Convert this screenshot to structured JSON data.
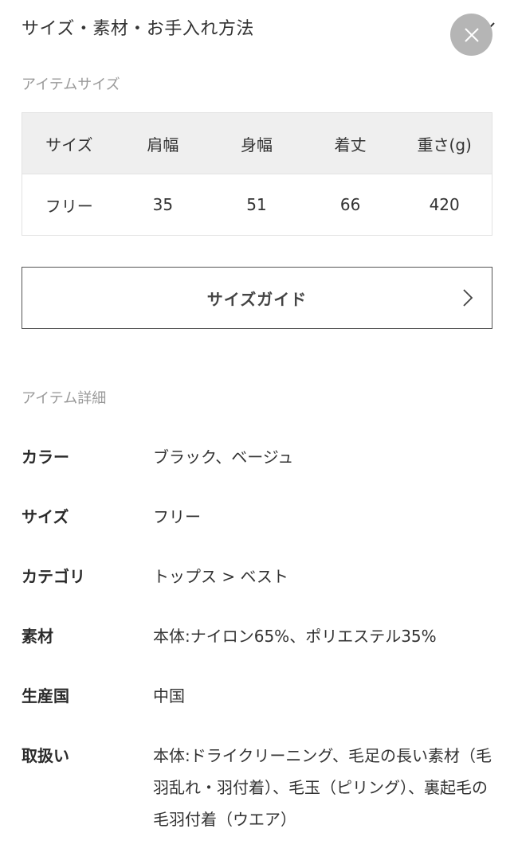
{
  "header": {
    "title": "サイズ・素材・お手入れ方法"
  },
  "item_size": {
    "label": "アイテムサイズ",
    "columns": [
      "サイズ",
      "肩幅",
      "身幅",
      "着丈",
      "重さ(g)"
    ],
    "rows": [
      [
        "フリー",
        "35",
        "51",
        "66",
        "420"
      ]
    ]
  },
  "size_guide": {
    "label": "サイズガイド"
  },
  "item_detail": {
    "label": "アイテム詳細",
    "rows": [
      {
        "key": "カラー",
        "value": "ブラック、ベージュ"
      },
      {
        "key": "サイズ",
        "value": "フリー"
      },
      {
        "key": "カテゴリ",
        "value": "トップス > ベスト"
      },
      {
        "key": "素材",
        "value": "本体:ナイロン65%、ポリエステル35%"
      },
      {
        "key": "生産国",
        "value": "中国"
      },
      {
        "key": "取扱い",
        "value": "本体:ドライクリーニング、毛足の長い素材（毛羽乱れ・羽付着）、毛玉（ピリング）、裏起毛の毛羽付着（ウエア）"
      }
    ]
  },
  "icons": {
    "close": "close-icon",
    "chevron": "chevron-down-icon",
    "arrow": "chevron-right-icon"
  }
}
